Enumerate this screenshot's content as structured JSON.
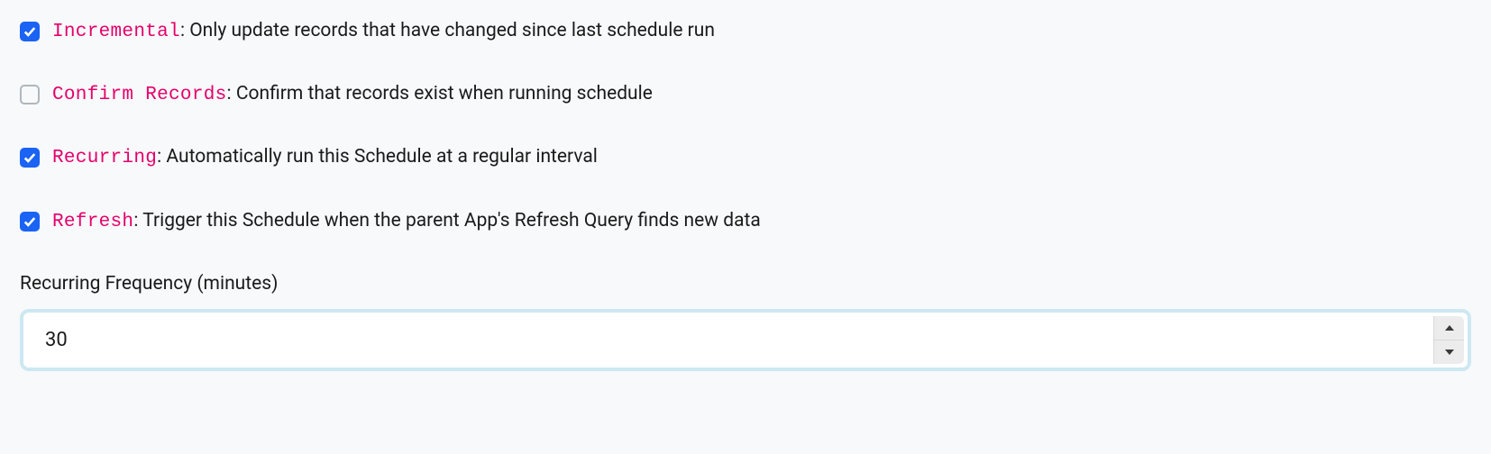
{
  "options": {
    "incremental": {
      "key": "Incremental",
      "desc": "Only update records that have changed since last schedule run",
      "checked": true
    },
    "confirm_records": {
      "key": "Confirm Records",
      "desc": "Confirm that records exist when running schedule",
      "checked": false
    },
    "recurring": {
      "key": "Recurring",
      "desc": "Automatically run this Schedule at a regular interval",
      "checked": true
    },
    "refresh": {
      "key": "Refresh",
      "desc": "Trigger this Schedule when the parent App's Refresh Query finds new data",
      "checked": true
    }
  },
  "recurring_frequency": {
    "label": "Recurring Frequency (minutes)",
    "value": "30"
  }
}
